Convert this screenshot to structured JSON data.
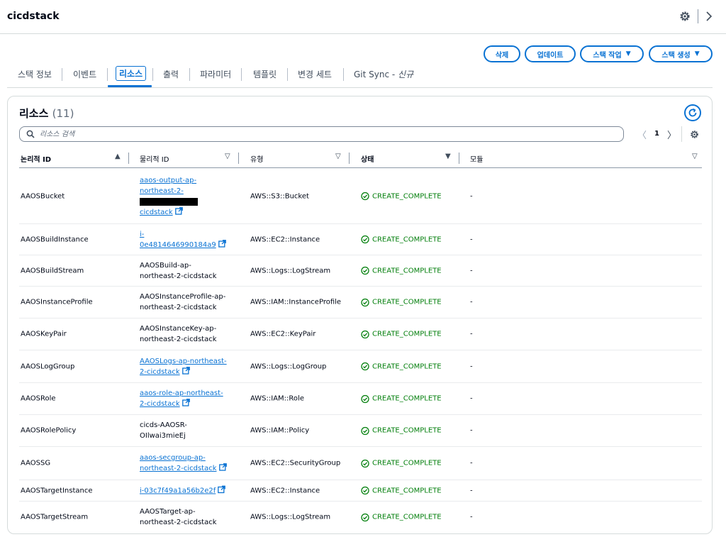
{
  "app": {
    "title": "cicdstack"
  },
  "actions": {
    "delete": "삭제",
    "update": "업데이트",
    "stack_actions": "스택 작업",
    "create_stack": "스택 생성"
  },
  "tabs": [
    {
      "label": "스택 정보"
    },
    {
      "label": "이벤트"
    },
    {
      "label": "리소스"
    },
    {
      "label": "출력"
    },
    {
      "label": "파라미터"
    },
    {
      "label": "템플릿"
    },
    {
      "label": "변경 세트"
    },
    {
      "label": "Git Sync - ",
      "suffix": "신규"
    }
  ],
  "resources": {
    "title": "리소스",
    "count": "(11)",
    "search_placeholder": "리소스 검색",
    "page": "1",
    "columns": {
      "logical_id": "논리적 ID",
      "physical_id": "물리적 ID",
      "type": "유형",
      "status": "상태",
      "module": "모듈"
    },
    "rows": [
      {
        "logical": "AAOSBucket",
        "physical_parts": [
          "aaos-output-ap-",
          "northeast-2-",
          "cicdstack"
        ],
        "physical_link": true,
        "redacted": true,
        "type": "AWS::S3::Bucket",
        "status": "CREATE_COMPLETE",
        "module": "-"
      },
      {
        "logical": "AAOSBuildInstance",
        "physical_parts": [
          "i-",
          "0e4814646990184a9"
        ],
        "physical_link": true,
        "type": "AWS::EC2::Instance",
        "status": "CREATE_COMPLETE",
        "module": "-"
      },
      {
        "logical": "AAOSBuildStream",
        "physical_parts": [
          "AAOSBuild-ap-",
          "northeast-2-cicdstack"
        ],
        "physical_link": false,
        "type": "AWS::Logs::LogStream",
        "status": "CREATE_COMPLETE",
        "module": "-"
      },
      {
        "logical": "AAOSInstanceProfile",
        "physical_parts": [
          "AAOSInstanceProfile-ap-",
          "northeast-2-cicdstack"
        ],
        "physical_link": false,
        "type": "AWS::IAM::InstanceProfile",
        "status": "CREATE_COMPLETE",
        "module": "-"
      },
      {
        "logical": "AAOSKeyPair",
        "physical_parts": [
          "AAOSInstanceKey-ap-",
          "northeast-2-cicdstack"
        ],
        "physical_link": false,
        "type": "AWS::EC2::KeyPair",
        "status": "CREATE_COMPLETE",
        "module": "-"
      },
      {
        "logical": "AAOSLogGroup",
        "physical_parts": [
          "AAOSLogs-ap-northeast-",
          "2-cicdstack"
        ],
        "physical_link": true,
        "type": "AWS::Logs::LogGroup",
        "status": "CREATE_COMPLETE",
        "module": "-"
      },
      {
        "logical": "AAOSRole",
        "physical_parts": [
          "aaos-role-ap-northeast-",
          "2-cicdstack"
        ],
        "physical_link": true,
        "type": "AWS::IAM::Role",
        "status": "CREATE_COMPLETE",
        "module": "-"
      },
      {
        "logical": "AAOSRolePolicy",
        "physical_parts": [
          "cicds-AAOSR-",
          "OIlwai3mieEj"
        ],
        "physical_link": false,
        "type": "AWS::IAM::Policy",
        "status": "CREATE_COMPLETE",
        "module": "-"
      },
      {
        "logical": "AAOSSG",
        "physical_parts": [
          "aaos-secgroup-ap-",
          "northeast-2-cicdstack"
        ],
        "physical_link": true,
        "type": "AWS::EC2::SecurityGroup",
        "status": "CREATE_COMPLETE",
        "module": "-"
      },
      {
        "logical": "AAOSTargetInstance",
        "physical_parts": [
          "i-03c7f49a1a56b2e2f"
        ],
        "physical_link": true,
        "type": "AWS::EC2::Instance",
        "status": "CREATE_COMPLETE",
        "module": "-"
      },
      {
        "logical": "AAOSTargetStream",
        "physical_parts": [
          "AAOSTarget-ap-",
          "northeast-2-cicdstack"
        ],
        "physical_link": false,
        "type": "AWS::Logs::LogStream",
        "status": "CREATE_COMPLETE",
        "module": "-"
      }
    ]
  },
  "colors": {
    "accent": "#0972d3",
    "success": "#037f0c",
    "text": "#000716",
    "border": "#d5dbdb"
  }
}
